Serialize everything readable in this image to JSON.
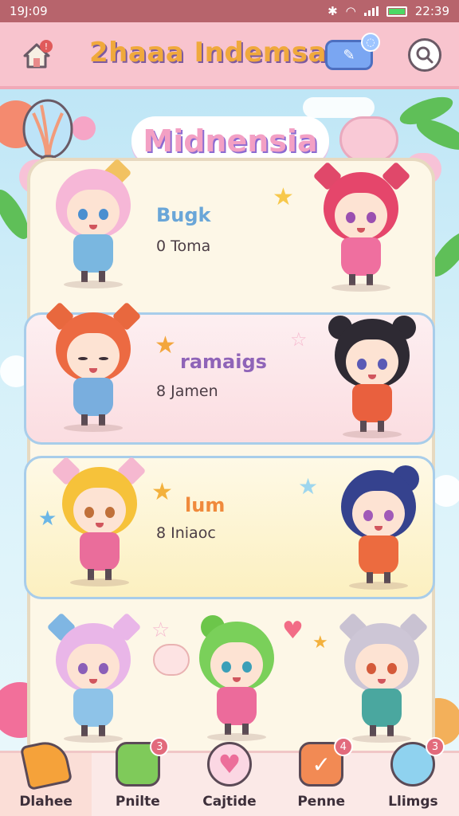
{
  "status_bar": {
    "time_left": "19J:09",
    "time_right": "22:39"
  },
  "header": {
    "title": "2haaa Indemsa"
  },
  "banner": {
    "title": "Midnensia"
  },
  "rows": [
    {
      "name": "Bugk",
      "sub": "0 Toma"
    },
    {
      "name": "ramaigs",
      "sub": "8 Jamen"
    },
    {
      "name": "lum",
      "sub": "8 Iniaoc"
    }
  ],
  "bottom_nav": {
    "items": [
      {
        "label": "Dlahee",
        "badge": ""
      },
      {
        "label": "Pnilte",
        "badge": "3"
      },
      {
        "label": "Cajtide",
        "badge": ""
      },
      {
        "label": "Penne",
        "badge": "4"
      },
      {
        "label": "Llimgs",
        "badge": "3"
      }
    ]
  },
  "colors": {
    "header_bg": "#f8c4ce",
    "status_bg": "#b7646c",
    "board_bg": "#fdf7e7",
    "accent_purple": "#8f64b8"
  }
}
